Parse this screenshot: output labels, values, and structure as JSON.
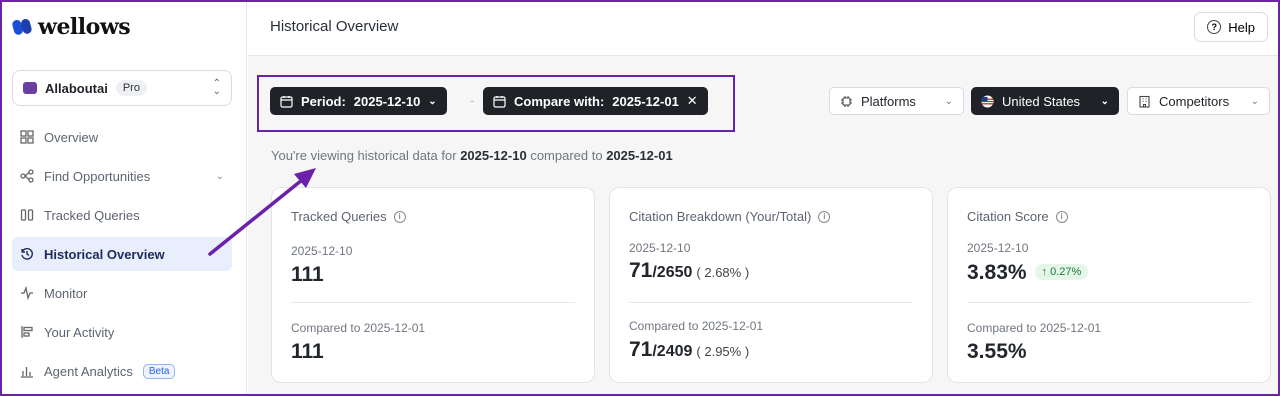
{
  "brand": {
    "logo_text": "wellows"
  },
  "workspace": {
    "name": "Allaboutai",
    "plan": "Pro"
  },
  "sidebar": {
    "items": [
      {
        "label": "Overview",
        "icon": "grid-icon"
      },
      {
        "label": "Find Opportunities",
        "icon": "nodes-icon",
        "has_chevron": true
      },
      {
        "label": "Tracked Queries",
        "icon": "quote-icon"
      },
      {
        "label": "Historical Overview",
        "icon": "history-icon",
        "active": true
      },
      {
        "label": "Monitor",
        "icon": "pulse-icon"
      },
      {
        "label": "Your Activity",
        "icon": "activity-icon"
      },
      {
        "label": "Agent Analytics",
        "icon": "bar-chart-icon",
        "badge": "Beta"
      }
    ]
  },
  "header": {
    "title": "Historical Overview",
    "help_label": "Help"
  },
  "filters": {
    "period_label": "Period:",
    "period_value": "2025-12-10",
    "separator": "-",
    "compare_label": "Compare with:",
    "compare_value": "2025-12-01",
    "platforms_label": "Platforms",
    "country_label": "United States",
    "competitors_label": "Competitors"
  },
  "viewing": {
    "prefix": "You're viewing historical data for",
    "date1": "2025-12-10",
    "mid": "compared to",
    "date2": "2025-12-01"
  },
  "cards": {
    "tracked": {
      "title": "Tracked Queries",
      "date": "2025-12-10",
      "value": "111",
      "compare_label": "Compared to 2025-12-01",
      "compare_value": "111"
    },
    "citation_breakdown": {
      "title": "Citation Breakdown (Your/Total)",
      "date": "2025-12-10",
      "yours": "71",
      "total": "/2650",
      "pct": "( 2.68% )",
      "compare_label": "Compared to 2025-12-01",
      "compare_yours": "71",
      "compare_total": "/2409",
      "compare_pct": "( 2.95% )"
    },
    "citation_score": {
      "title": "Citation Score",
      "date": "2025-12-10",
      "value": "3.83%",
      "delta": "↑ 0.27%",
      "compare_label": "Compared to 2025-12-01",
      "compare_value": "3.55%"
    }
  },
  "colors": {
    "annotation": "#6b21a8",
    "active_nav_bg": "#e9eefc",
    "dark_pill": "#1f2226",
    "delta_green": "#1b7a3a"
  }
}
